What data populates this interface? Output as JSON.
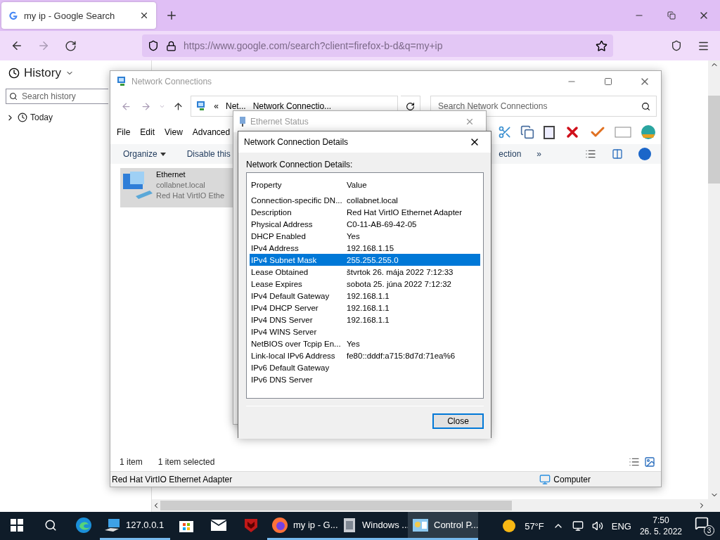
{
  "browser": {
    "tab": {
      "title": "my ip - Google Search",
      "selected": true
    },
    "url": "https://www.google.com/search?client=firefox-b-d&q=my+ip",
    "forward_disabled": true,
    "sidebar": {
      "title": "History",
      "search_placeholder": "Search history",
      "items": [
        {
          "label": "Today",
          "expanded": false
        }
      ]
    }
  },
  "explorer": {
    "title": "Network Connections",
    "breadcrumb": [
      "«",
      "Net...",
      "Network Connectio..."
    ],
    "search_placeholder": "Search Network Connections",
    "menu": [
      "File",
      "Edit",
      "View",
      "Advanced"
    ],
    "commands": [
      "Organize",
      "Disable this"
    ],
    "commands_right": [
      "ection",
      "»"
    ],
    "items": [
      {
        "name": "Ethernet",
        "lines": [
          "collabnet.local",
          "Red Hat VirtIO Ethe"
        ],
        "selected": true
      }
    ],
    "status": [
      "1 item",
      "1 item selected"
    ],
    "details_bar": {
      "description": "Red Hat VirtIO Ethernet Adapter",
      "location": "Computer"
    }
  },
  "status_dialog": {
    "title": "Ethernet Status"
  },
  "details_dialog": {
    "title": "Network Connection Details",
    "label": "Network Connection Details:",
    "columns": [
      "Property",
      "Value"
    ],
    "rows": [
      {
        "property": "Connection-specific DN...",
        "value": "collabnet.local",
        "selected": false
      },
      {
        "property": "Description",
        "value": "Red Hat VirtIO Ethernet Adapter",
        "selected": false
      },
      {
        "property": "Physical Address",
        "value": "C0-11-AB-69-42-05",
        "selected": false
      },
      {
        "property": "DHCP Enabled",
        "value": "Yes",
        "selected": false
      },
      {
        "property": "IPv4 Address",
        "value": "192.168.1.15",
        "selected": false
      },
      {
        "property": "IPv4 Subnet Mask",
        "value": "255.255.255.0",
        "selected": true
      },
      {
        "property": "Lease Obtained",
        "value": "štvrtok 26. mája 2022 7:12:33",
        "selected": false
      },
      {
        "property": "Lease Expires",
        "value": "sobota 25. júna 2022 7:12:32",
        "selected": false
      },
      {
        "property": "IPv4 Default Gateway",
        "value": "192.168.1.1",
        "selected": false
      },
      {
        "property": "IPv4 DHCP Server",
        "value": "192.168.1.1",
        "selected": false
      },
      {
        "property": "IPv4 DNS Server",
        "value": "192.168.1.1",
        "selected": false
      },
      {
        "property": "IPv4 WINS Server",
        "value": "",
        "selected": false
      },
      {
        "property": "NetBIOS over Tcpip En...",
        "value": "Yes",
        "selected": false
      },
      {
        "property": "Link-local IPv6 Address",
        "value": "fe80::dddf:a715:8d7d:71ea%6",
        "selected": false
      },
      {
        "property": "IPv6 Default Gateway",
        "value": "",
        "selected": false
      },
      {
        "property": "IPv6 DNS Server",
        "value": "",
        "selected": false
      }
    ],
    "buttons": [
      "Close"
    ]
  },
  "taskbar": {
    "apps": [
      {
        "kind": "edge",
        "running": false,
        "selected": false
      },
      {
        "kind": "remote",
        "label": "127.0.0.1",
        "running": true,
        "selected": false
      },
      {
        "kind": "store",
        "running": false,
        "selected": false
      },
      {
        "kind": "mail",
        "running": false,
        "selected": false
      },
      {
        "kind": "shield",
        "running": false,
        "selected": false
      },
      {
        "kind": "firefox",
        "label": "my ip - G...",
        "running": true,
        "selected": false
      },
      {
        "kind": "windows",
        "label": "Windows ...",
        "running": true,
        "selected": false
      },
      {
        "kind": "control",
        "label": "Control P...",
        "running": true,
        "selected": true
      }
    ],
    "weather": "57°F",
    "language": "ENG",
    "time": "7:50",
    "date": "26. 5. 2022",
    "notifications": "3"
  }
}
